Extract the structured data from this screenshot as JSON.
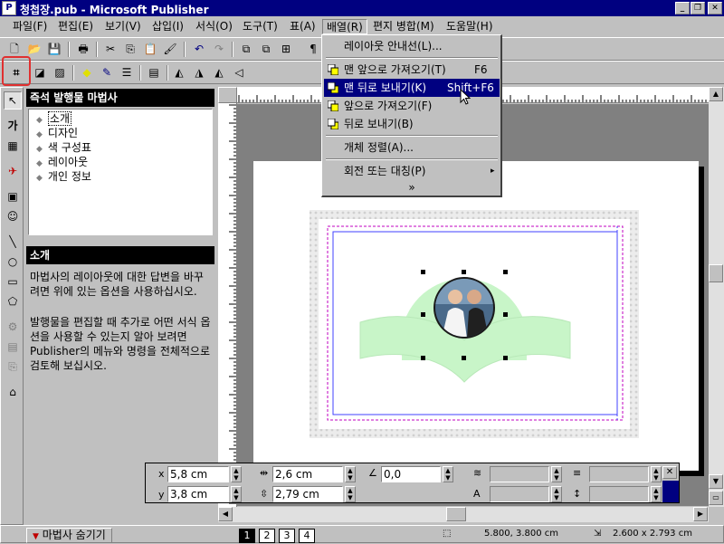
{
  "window": {
    "title": "청첩장.pub - Microsoft Publisher",
    "app_icon": "publisher-icon"
  },
  "menubar": [
    {
      "label": "파일(F)"
    },
    {
      "label": "편집(E)"
    },
    {
      "label": "보기(V)"
    },
    {
      "label": "삽입(I)"
    },
    {
      "label": "서식(O)"
    },
    {
      "label": "도구(T)"
    },
    {
      "label": "표(A)"
    },
    {
      "label": "배열(R)"
    },
    {
      "label": "편지 병합(M)"
    },
    {
      "label": "도움말(H)"
    }
  ],
  "arrange_menu": {
    "items": [
      {
        "label": "레이아웃 안내선(L)...",
        "shortcut": ""
      },
      {
        "label": "맨 앞으로 가져오기(T)",
        "shortcut": "F6"
      },
      {
        "label": "맨 뒤로 보내기(K)",
        "shortcut": "Shift+F6"
      },
      {
        "label": "앞으로 가져오기(F)",
        "shortcut": ""
      },
      {
        "label": "뒤로 보내기(B)",
        "shortcut": ""
      },
      {
        "label": "개체 정렬(A)...",
        "shortcut": ""
      },
      {
        "label": "회전 또는 대칭(P)",
        "shortcut": "▸"
      }
    ],
    "expand": "»"
  },
  "wizard": {
    "title": "즉석 발행물 마법사",
    "items": [
      {
        "label": "소개"
      },
      {
        "label": "디자인"
      },
      {
        "label": "색 구성표"
      },
      {
        "label": "레이아웃"
      },
      {
        "label": "개인 정보"
      }
    ],
    "section_title": "소개",
    "desc1": "마법사의 레이아웃에 대한 답변을 바꾸려면 위에 있는 옵션을 사용하십시오.",
    "desc2": "발행물을 편집할 때 추가로 어떤 서식 옵션을 사용할 수 있는지 알아 보려면 Publisher의 메뉴와 명령을 전체적으로 검토해 보십시오."
  },
  "measurements": {
    "x_label": "x",
    "x_value": "5,8 cm",
    "y_label": "y",
    "y_value": "3,8 cm",
    "w_value": "2,6 cm",
    "h_value": "2,79 cm",
    "angle_value": "0,0"
  },
  "statusbar": {
    "hide_wizard": "마법사 숨기기",
    "pages": [
      "1",
      "2",
      "3",
      "4"
    ],
    "position": "5.800, 3.800 cm",
    "size": "2.600 x 2.793 cm"
  },
  "colors": {
    "titlebar": "#000080",
    "highlight": "#000080",
    "shape_fill": "#c8f5c8",
    "guide_blue": "#4040ff",
    "guide_magenta": "#c000c0"
  }
}
